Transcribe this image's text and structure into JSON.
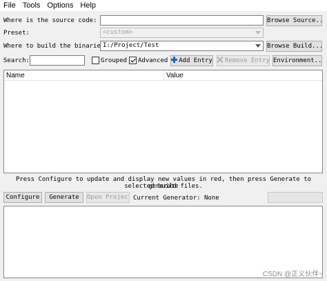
{
  "menu": {
    "items": [
      "File",
      "Tools",
      "Options",
      "Help"
    ]
  },
  "source": {
    "label": "Where is the source code:",
    "value": "",
    "browse_label": "Browse Source..."
  },
  "preset": {
    "label": "Preset:",
    "value": "<custom>"
  },
  "build": {
    "label": "Where to build the binaries:",
    "value": "I:/Project/Test",
    "browse_label": "Browse Build..."
  },
  "search": {
    "label": "Search:",
    "value": ""
  },
  "options": {
    "grouped_label": "Grouped",
    "grouped_checked": false,
    "advanced_label": "Advanced",
    "advanced_checked": true
  },
  "toolbar": {
    "add_entry_label": "Add Entry",
    "remove_entry_label": "Remove Entry",
    "environment_label": "Environment..."
  },
  "table": {
    "columns": [
      "Name",
      "Value"
    ]
  },
  "info": {
    "line1": "Press Configure to update and display new values in red, then press Generate to generate",
    "line2": "selected build files."
  },
  "actions": {
    "configure_label": "Configure",
    "generate_label": "Generate",
    "open_project_label": "Open Project",
    "current_generator": "Current Generator: None"
  },
  "watermark": "CSDN @正义伙伴~"
}
